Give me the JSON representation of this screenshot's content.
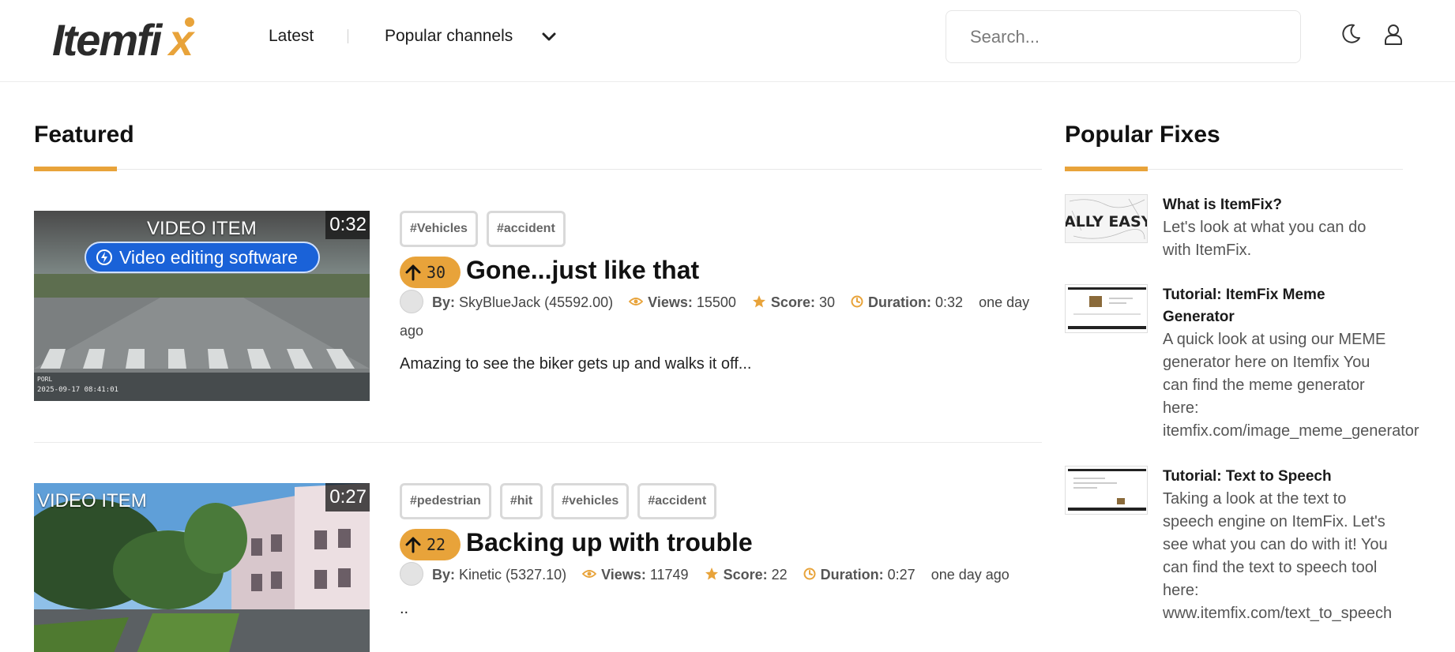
{
  "header": {
    "logo_text": "Itemfix",
    "nav": {
      "latest": "Latest",
      "popular": "Popular channels"
    },
    "search_placeholder": "Search..."
  },
  "featured": {
    "title": "Featured",
    "items": [
      {
        "thumb_label": "VIDEO ITEM",
        "duration_badge": "0:32",
        "promo": "Video editing software",
        "timestamp_overlay": "2025-09-17 08:41:01",
        "tags": [
          "#Vehicles",
          "#accident"
        ],
        "votes": "30",
        "title": "Gone...just like that",
        "by_label": "By:",
        "author": "SkyBlueJack (45592.00)",
        "views_label": "Views:",
        "views": "15500",
        "score_label": "Score:",
        "score": "30",
        "duration_label": "Duration:",
        "duration": "0:32",
        "age": "one day ago",
        "description": "Amazing to see the biker gets up and walks it off..."
      },
      {
        "thumb_label": "VIDEO ITEM",
        "duration_badge": "0:27",
        "tags": [
          "#pedestrian",
          "#hit",
          "#vehicles",
          "#accident"
        ],
        "votes": "22",
        "title": "Backing up with trouble",
        "by_label": "By:",
        "author": "Kinetic (5327.10)",
        "views_label": "Views:",
        "views": "11749",
        "score_label": "Score:",
        "score": "22",
        "duration_label": "Duration:",
        "duration": "0:27",
        "age": "one day ago",
        "description": ".."
      }
    ]
  },
  "popular": {
    "title": "Popular Fixes",
    "items": [
      {
        "thumb_text": "ALLY EASY",
        "title": "What is ItemFix?",
        "text": "Let's look at what you can do\nwith ItemFix."
      },
      {
        "title": "Tutorial: ItemFix Meme\nGenerator",
        "text": "A quick look at using our MEME\ngenerator here on Itemfix You\ncan find the meme generator\nhere:\nitemfix.com/image_meme_generator"
      },
      {
        "title": "Tutorial: Text to Speech",
        "text": "Taking a look at the text to\nspeech engine on ItemFix. Let's\nsee what you can do with it! You\ncan find the text to speech tool\nhere:\nwww.itemfix.com/text_to_speech"
      }
    ]
  },
  "colors": {
    "accent": "#e8a33a",
    "promo_blue": "#1a62d8"
  }
}
